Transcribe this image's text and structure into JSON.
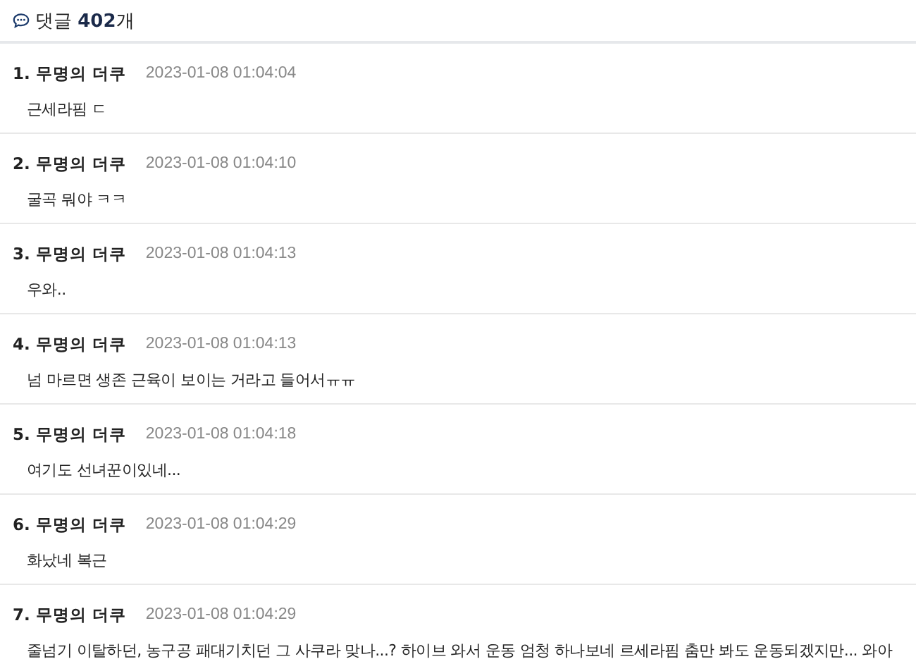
{
  "header": {
    "title": "댓글 **402**개"
  },
  "comments": [
    {
      "number": "1.",
      "author": "무명의 더쿠",
      "time": "2023-01-08 01:04:04",
      "text": "근세라핌 ㄷ"
    },
    {
      "number": "2.",
      "author": "무명의 더쿠",
      "time": "2023-01-08 01:04:10",
      "text": "굴곡 뭐야 ㅋㅋ"
    },
    {
      "number": "3.",
      "author": "무명의 더쿠",
      "time": "2023-01-08 01:04:13",
      "text": "우와.."
    },
    {
      "number": "4.",
      "author": "무명의 더쿠",
      "time": "2023-01-08 01:04:13",
      "text": "넘 마르면 생존 근육이 보이는 거라고 들어서ㅠㅠ"
    },
    {
      "number": "5.",
      "author": "무명의 더쿠",
      "time": "2023-01-08 01:04:18",
      "text": "여기도 선녀꾼이있네..."
    },
    {
      "number": "6.",
      "author": "무명의 더쿠",
      "time": "2023-01-08 01:04:29",
      "text": "화났네 복근"
    },
    {
      "number": "7.",
      "author": "무명의 더쿠",
      "time": "2023-01-08 01:04:29",
      "text": "줄넘기 이탈하던, 농구공 패대기치던 그 사쿠라 맞나...? 하이브 와서 운동 엄청 하나보네 르세라핌 춤만 봐도 운동되겠지만... 와아"
    }
  ]
}
